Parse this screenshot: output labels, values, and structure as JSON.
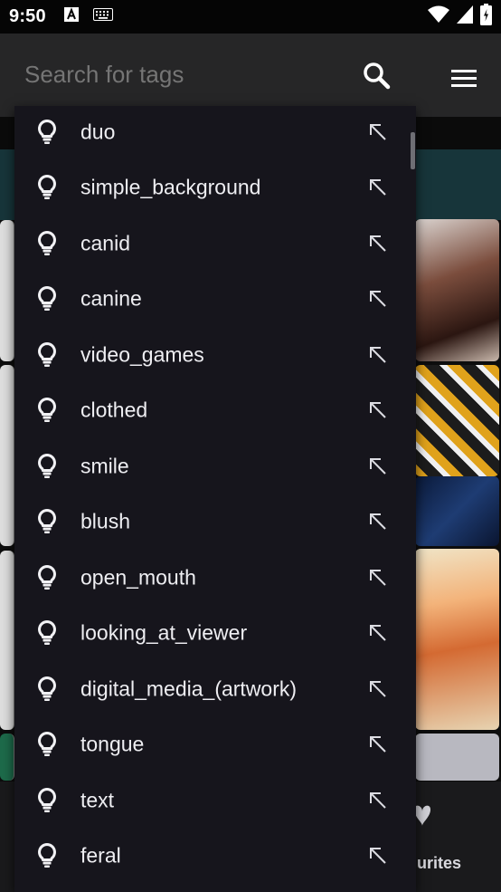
{
  "status_bar": {
    "time": "9:50",
    "left_icons": [
      "text-a-icon",
      "keyboard-icon"
    ],
    "right_icons": [
      "wifi-icon",
      "signal-icon",
      "battery-icon"
    ]
  },
  "search": {
    "placeholder": "Search for tags",
    "icon": "search-icon",
    "menu_icon": "hamburger-menu-icon"
  },
  "suggestions": [
    {
      "label": "duo"
    },
    {
      "label": "simple_background"
    },
    {
      "label": "canid"
    },
    {
      "label": "canine"
    },
    {
      "label": "video_games"
    },
    {
      "label": "clothed"
    },
    {
      "label": "smile"
    },
    {
      "label": "blush"
    },
    {
      "label": "open_mouth"
    },
    {
      "label": "looking_at_viewer"
    },
    {
      "label": "digital_media_(artwork)"
    },
    {
      "label": "tongue"
    },
    {
      "label": "text"
    },
    {
      "label": "feral"
    }
  ],
  "suggestion_icons": {
    "leading": "lightbulb-icon",
    "trailing": "arrow-up-left-icon"
  },
  "bottom_nav": {
    "favourites_label": "urites"
  },
  "colors": {
    "appbar": "#262627",
    "dropdown": "#16151c",
    "teal_band": "#17353a"
  }
}
